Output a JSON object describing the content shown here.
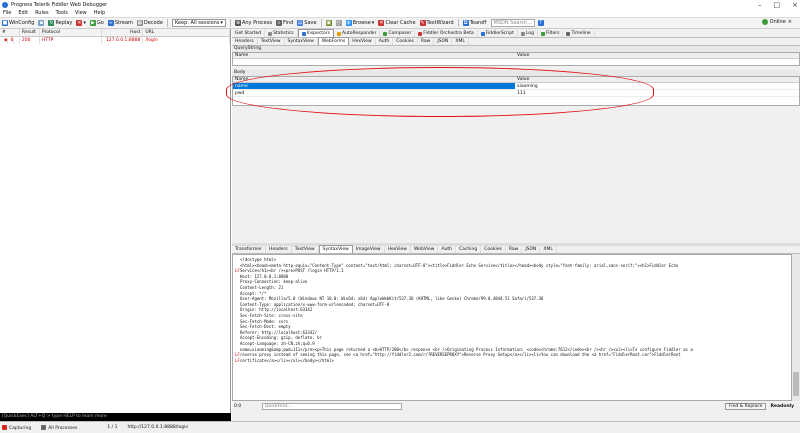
{
  "window": {
    "title": "Progress Telerik Fiddler Web Debugger"
  },
  "menu": [
    "File",
    "Edit",
    "Rules",
    "Tools",
    "View",
    "Help"
  ],
  "toolbar": {
    "items": [
      "WinConfig",
      "Replay",
      "Go",
      "Stream",
      "Decode",
      "Keep: All sessions",
      "Any Process",
      "Find",
      "Save",
      "Browse",
      "Clear Cache",
      "TextWizard",
      "Tearoff"
    ],
    "msdn_placeholder": "MSDN Search...",
    "online_label": "Online"
  },
  "sessions": {
    "columns": [
      "#",
      "Result",
      "Protocol",
      "Host",
      "URL"
    ],
    "rows": [
      {
        "id": "6",
        "result": "200",
        "protocol": "HTTP",
        "host": "127.0.0.1:8888",
        "url": "/login"
      }
    ],
    "quickexec": "[QuickExec] ALT+Q > type HELP to learn more"
  },
  "inspector": {
    "top_tabs": [
      "Get Started",
      "Statistics",
      "Inspectors",
      "AutoResponder",
      "Composer",
      "Fiddler Orchestra Beta",
      "FiddlerScript",
      "Log",
      "Filters",
      "Timeline"
    ],
    "request_tabs": [
      "Headers",
      "TextView",
      "SyntaxView",
      "WebForms",
      "HexView",
      "Auth",
      "Cookies",
      "Raw",
      "JSON",
      "XML"
    ],
    "querystring_label": "QueryString",
    "name_col": "Name",
    "value_col": "Value",
    "body_label": "Body",
    "body_rows": [
      {
        "name": "name",
        "value": "xiaoming"
      },
      {
        "name": "pwd",
        "value": "111"
      }
    ],
    "response_tabs": [
      "Transformer",
      "Headers",
      "TextView",
      "SyntaxView",
      "ImageView",
      "HexView",
      "WebView",
      "Auth",
      "Caching",
      "Cookies",
      "Raw",
      "JSON",
      "XML"
    ],
    "raw_lines": [
      {
        "g": "",
        "t": "<!doctype html>"
      },
      {
        "g": "",
        "t": "<html><head><meta http-equiv=\"Content-Type\" content=\"text/html; charset=UTF-8\"><title>Fiddler Echo Service</title></head><body style=\"font-family: arial,sans-serif;\"><h1>Fiddler Echo"
      },
      {
        "g": "LF",
        "t": "Service</h1><br /><pre>POST /login HTTP/1.1"
      },
      {
        "g": "",
        "t": "Host: 127.0.0.1:8888"
      },
      {
        "g": "",
        "t": "Proxy-Connection: keep-alive"
      },
      {
        "g": "",
        "t": "Content-Length: 21"
      },
      {
        "g": "",
        "t": "Accept: */*"
      },
      {
        "g": "",
        "t": "User-Agent: Mozilla/5.0 (Windows NT 10.0; Win64; x64) AppleWebKit/537.36 (KHTML, like Gecko) Chrome/99.0.4844.51 Safari/537.36"
      },
      {
        "g": "",
        "t": "Content-Type: application/x-www-form-urlencoded; charset=UTF-8"
      },
      {
        "g": "",
        "t": "Origin: http://localhost:63342"
      },
      {
        "g": "",
        "t": "Sec-Fetch-Site: cross-site"
      },
      {
        "g": "",
        "t": "Sec-Fetch-Mode: cors"
      },
      {
        "g": "",
        "t": "Sec-Fetch-Dest: empty"
      },
      {
        "g": "",
        "t": "Referer: http://localhost:63342/"
      },
      {
        "g": "",
        "t": "Accept-Encoding: gzip, deflate, br"
      },
      {
        "g": "",
        "t": "Accept-Language: zh-CN,zh;q=0.9"
      },
      {
        "g": "",
        "t": ""
      },
      {
        "g": "",
        "t": "name=xiaoming&amp;pwd=111</pre><p>This page returned a <b>HTTP/200</b> response <br />Originating Process Information: <code>chrome:7612</code><br /><hr /><ul><li>To configure Fiddler as a"
      },
      {
        "g": "LF",
        "t": "reverse proxy instead of seeing this page, see <a href=\"http://fiddler2.com/r/?REVERSEPROXY\">Reverse Proxy Setup</a></li><li>You can download the <a href=\"FiddlerRoot.cer\">FiddlerRoot"
      },
      {
        "g": "LF",
        "t": "certificate</a></li></ul></body></html>"
      }
    ],
    "zoom": "0:0",
    "find_placeholder": "QuickFind...",
    "find_replace_label": "Find & Replace",
    "readonly_label": "Readonly"
  },
  "status": {
    "capturing": "Capturing",
    "processes": "All Processes",
    "count": "1 / 1",
    "url": "http://127.0.0.1:8888/login"
  },
  "colors": {
    "accent": "#0078d7",
    "annotation": "#e01010",
    "error_text": "#cc0000"
  }
}
